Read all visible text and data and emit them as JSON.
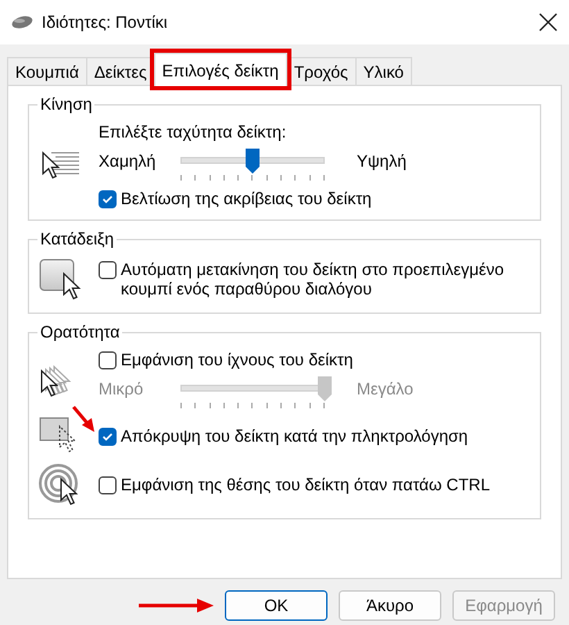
{
  "window": {
    "title": "Ιδιότητες: Ποντίκι"
  },
  "tabs": [
    {
      "label": "Κουμπιά",
      "selected": false,
      "highlighted": false
    },
    {
      "label": "Δείκτες",
      "selected": false,
      "highlighted": false
    },
    {
      "label": "Επιλογές δείκτη",
      "selected": true,
      "highlighted": true
    },
    {
      "label": "Τροχός",
      "selected": false,
      "highlighted": false
    },
    {
      "label": "Υλικό",
      "selected": false,
      "highlighted": false
    }
  ],
  "groups": [
    {
      "title": "Κίνηση",
      "rows": [
        {
          "kind": "speed",
          "controls": [
            {
              "kind": "label",
              "text": "Επιλέξτε ταχύτητα δείκτη:"
            },
            {
              "kind": "slider",
              "min_label": "Χαμηλή",
              "max_label": "Υψηλή",
              "level": 0.5,
              "disabled": false
            },
            {
              "kind": "checkbox",
              "label": "Βελτίωση της ακρίβειας του δείκτη",
              "checked": true,
              "arrow": false
            }
          ]
        }
      ]
    },
    {
      "title": "Κατάδειξη",
      "rows": [
        {
          "kind": "snap",
          "controls": [
            {
              "kind": "checkbox",
              "label": "Αυτόματη μετακίνηση του δείκτη στο προεπιλεγμένο κουμπί ενός παραθύρου διαλόγου",
              "checked": false,
              "arrow": false
            }
          ]
        }
      ]
    },
    {
      "title": "Ορατότητα",
      "rows": [
        {
          "kind": "trails",
          "controls": [
            {
              "kind": "checkbox",
              "label": "Εμφάνιση του ίχνους του δείκτη",
              "checked": false,
              "arrow": false
            },
            {
              "kind": "slider",
              "min_label": "Μικρό",
              "max_label": "Μεγάλο",
              "level": 1,
              "disabled": true
            }
          ]
        },
        {
          "kind": "hide",
          "controls": [
            {
              "kind": "checkbox",
              "label": "Απόκρυψη του δείκτη κατά την πληκτρολόγηση",
              "checked": true,
              "arrow": true
            }
          ]
        },
        {
          "kind": "locate",
          "controls": [
            {
              "kind": "checkbox",
              "label": "Εμφάνιση της θέσης του δείκτη όταν πατάω CTRL",
              "checked": false,
              "arrow": false
            }
          ]
        }
      ]
    }
  ],
  "buttons": [
    {
      "label": "OK",
      "default": true,
      "disabled": false,
      "arrow": true
    },
    {
      "label": "Άκυρο",
      "default": false,
      "disabled": false,
      "arrow": false
    },
    {
      "label": "Εφαρμογή",
      "default": false,
      "disabled": true,
      "arrow": false
    }
  ]
}
